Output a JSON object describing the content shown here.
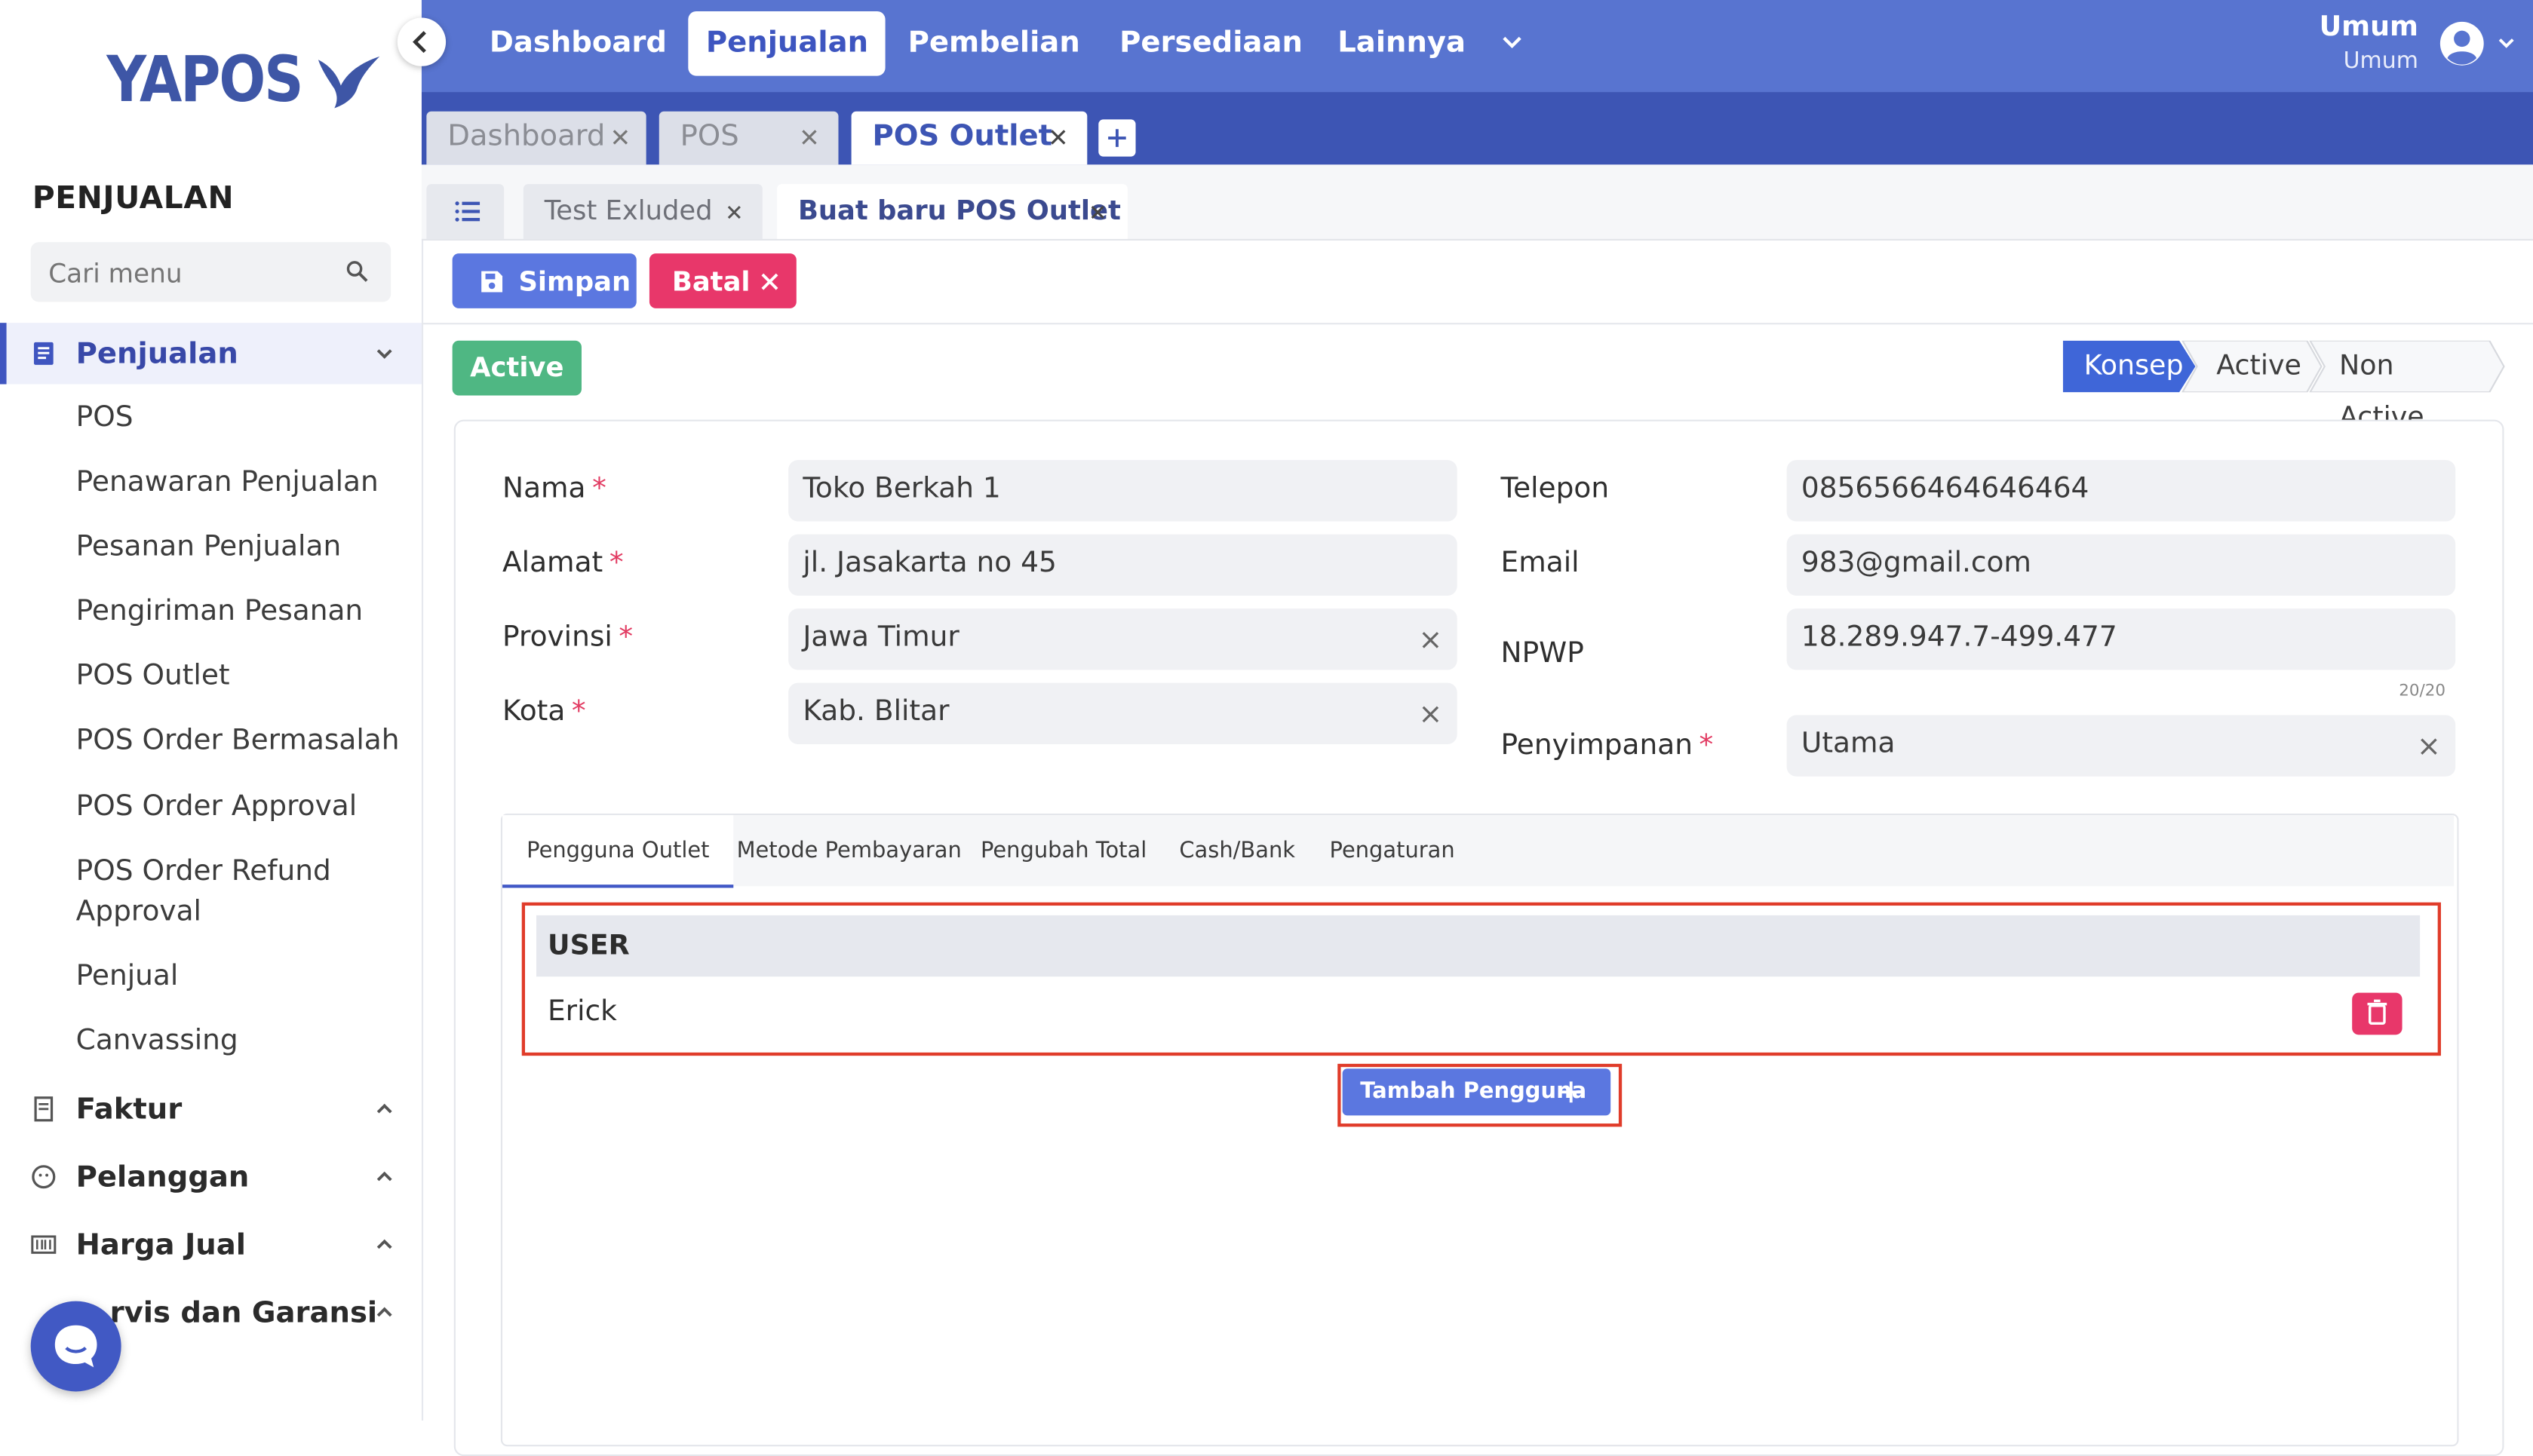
{
  "app": {
    "logo_text": "YAPOS"
  },
  "sidebar": {
    "section_title": "PENJUALAN",
    "search_placeholder": "Cari menu",
    "groups": [
      {
        "label": "Penjualan",
        "expanded": true
      },
      {
        "label": "Faktur"
      },
      {
        "label": "Pelanggan"
      },
      {
        "label": "Harga Jual"
      },
      {
        "label": "rvis dan Garansi"
      }
    ],
    "items": [
      "POS",
      "Penawaran Penjualan",
      "Pesanan Penjualan",
      "Pengiriman Pesanan",
      "POS Outlet",
      "POS Order Bermasalah",
      "POS Order Approval",
      "POS Order Refund Approval",
      "Penjual",
      "Canvassing"
    ]
  },
  "topnav": {
    "items": [
      "Dashboard",
      "Penjualan",
      "Pembelian",
      "Persediaan",
      "Lainnya"
    ],
    "active": "Penjualan",
    "user_name": "Umum",
    "user_role": "Umum"
  },
  "window_tabs": [
    {
      "label": "Dashboard"
    },
    {
      "label": "POS"
    },
    {
      "label": "POS Outlet",
      "active": true
    }
  ],
  "sub_tabs": [
    {
      "label": "Test Exluded"
    },
    {
      "label": "Buat baru POS Outlet",
      "active": true
    }
  ],
  "toolbar": {
    "save_label": "Simpan",
    "cancel_label": "Batal"
  },
  "status": {
    "badge": "Active",
    "stages": [
      "Konsep",
      "Active",
      "Non Active"
    ],
    "current_stage": "Konsep"
  },
  "form": {
    "nama": {
      "label": "Nama",
      "value": "Toko Berkah 1"
    },
    "alamat": {
      "label": "Alamat",
      "value": "jl. Jasakarta no 45"
    },
    "provinsi": {
      "label": "Provinsi",
      "value": "Jawa Timur"
    },
    "kota": {
      "label": "Kota",
      "value": "Kab. Blitar"
    },
    "telepon": {
      "label": "Telepon",
      "value": "0856566464646464"
    },
    "email": {
      "label": "Email",
      "value": "983@gmail.com"
    },
    "npwp": {
      "label": "NPWP",
      "value": "18.289.947.7-499.477",
      "counter": "20/20"
    },
    "penyimpanan": {
      "label": "Penyimpanan",
      "value": "Utama"
    },
    "required_mark": "*"
  },
  "inner_tabs": [
    "Pengguna Outlet",
    "Metode Pembayaran",
    "Pengubah Total",
    "Cash/Bank",
    "Pengaturan"
  ],
  "users_table": {
    "header": "USER",
    "rows": [
      "Erick"
    ],
    "add_label": "Tambah Pengguna"
  },
  "colors": {
    "nav_blue": "#5874d0",
    "tab_strip": "#3d55b4",
    "primary_button": "#5b77e0",
    "danger": "#e8376a",
    "success": "#4fb783",
    "highlight": "#e03c2a"
  }
}
